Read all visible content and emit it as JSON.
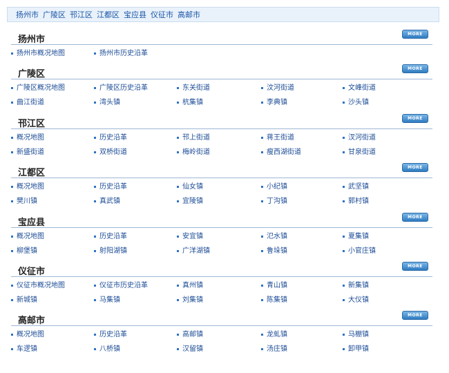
{
  "top_nav": [
    "扬州市",
    "广陵区",
    "邗江区",
    "江都区",
    "宝应县",
    "仪征市",
    "高邮市"
  ],
  "more_label": "MORE",
  "sections": [
    {
      "title": "扬州市",
      "rows": [
        [
          "扬州市概况地图",
          "扬州市历史沿革"
        ]
      ]
    },
    {
      "title": "广陵区",
      "rows": [
        [
          "广陵区概况地图",
          "广陵区历史沿革",
          "东关街道",
          "汶河街道",
          "文峰街道"
        ],
        [
          "曲江街道",
          "湾头镇",
          "杭集镇",
          "李典镇",
          "沙头镇"
        ]
      ]
    },
    {
      "title": "邗江区",
      "rows": [
        [
          "概况地图",
          "历史沿革",
          "邗上街道",
          "蒋王街道",
          "汊河街道"
        ],
        [
          "新盛街道",
          "双桥街道",
          "梅岭街道",
          "瘦西湖街道",
          "甘泉街道"
        ]
      ]
    },
    {
      "title": "江都区",
      "rows": [
        [
          "概况地图",
          "历史沿革",
          "仙女镇",
          "小纪镇",
          "武坚镇"
        ],
        [
          "樊川镇",
          "真武镇",
          "宜陵镇",
          "丁沟镇",
          "郭村镇"
        ]
      ]
    },
    {
      "title": "宝应县",
      "rows": [
        [
          "概况地图",
          "历史沿革",
          "安宜镇",
          "氾水镇",
          "夏集镇"
        ],
        [
          "柳堡镇",
          "射阳湖镇",
          "广洋湖镇",
          "鲁垛镇",
          "小官庄镇"
        ]
      ]
    },
    {
      "title": "仪征市",
      "rows": [
        [
          "仪征市概况地图",
          "仪征市历史沿革",
          "真州镇",
          "青山镇",
          "新集镇"
        ],
        [
          "新城镇",
          "马集镇",
          "刘集镇",
          "陈集镇",
          "大仪镇"
        ]
      ]
    },
    {
      "title": "高邮市",
      "rows": [
        [
          "概况地图",
          "历史沿革",
          "高邮镇",
          "龙虬镇",
          "马棚镇"
        ],
        [
          "车逻镇",
          "八桥镇",
          "汉留镇",
          "汤庄镇",
          "卸甲镇"
        ]
      ]
    }
  ]
}
